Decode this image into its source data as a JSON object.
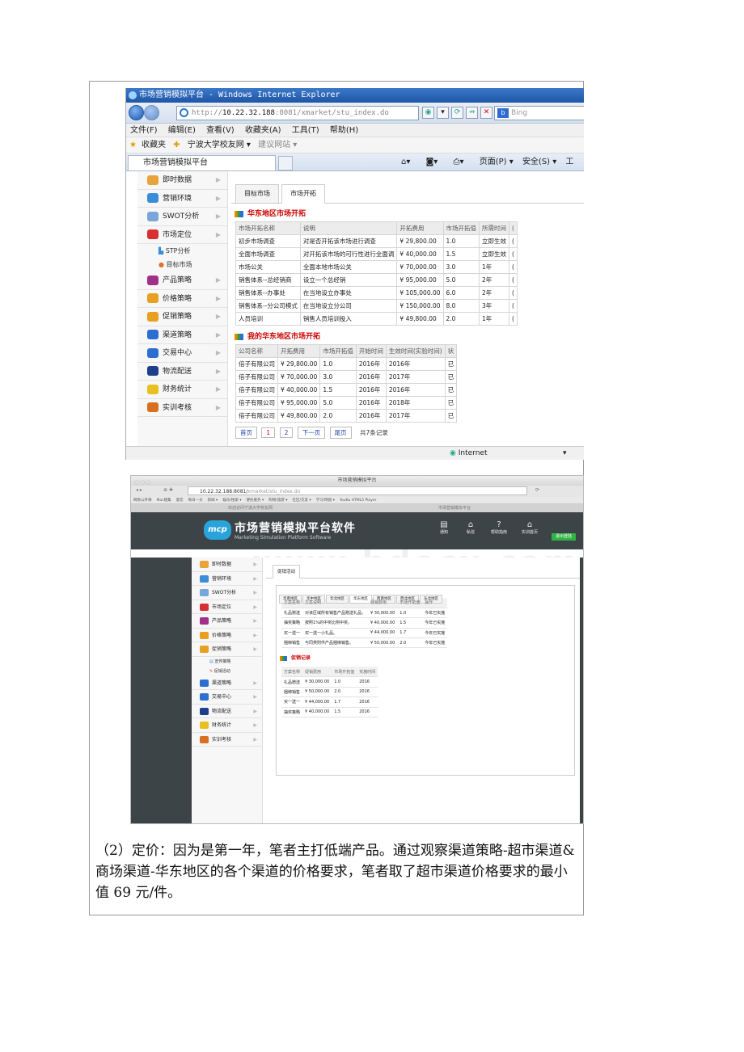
{
  "ie": {
    "title": "市场营销模拟平台 - Windows Internet Explorer",
    "url_prefix": "http://",
    "url_host": "10.22.32.188",
    "url_rest": ":8081/xmarket/stu_index.do",
    "search_placeholder": "Bing",
    "menu": [
      "文件(F)",
      "编辑(E)",
      "查看(V)",
      "收藏夹(A)",
      "工具(T)",
      "帮助(H)"
    ],
    "favorites": [
      "收藏夹",
      "宁波大学校友网 ▾",
      "建议网站 ▾"
    ],
    "tab_title": "市场营销模拟平台",
    "commands": [
      "▾",
      "▾",
      "▾",
      "页面(P) ▾",
      "安全(S) ▾",
      "工"
    ],
    "status_zone": "Internet",
    "status_zoom": "▾"
  },
  "sidebar1": {
    "items": [
      {
        "label": "即时数据",
        "color": "#e8a33a"
      },
      {
        "label": "营销环境",
        "color": "#3c8dd8"
      },
      {
        "label": "SWOT分析",
        "color": "#7aa5d8"
      },
      {
        "label": "市场定位",
        "color": "#d83030"
      }
    ],
    "subs": [
      "STP分析",
      "目标市场"
    ],
    "items2": [
      {
        "label": "产品策略",
        "color": "#a0308a"
      },
      {
        "label": "价格策略",
        "color": "#e8a020"
      },
      {
        "label": "促销策略",
        "color": "#e8a020"
      },
      {
        "label": "渠道策略",
        "color": "#2d6fd0"
      },
      {
        "label": "交易中心",
        "color": "#2d6fd0"
      },
      {
        "label": "物流配送",
        "color": "#1e3f8a"
      },
      {
        "label": "财务统计",
        "color": "#e8c020"
      },
      {
        "label": "实训考核",
        "color": "#d87020"
      }
    ]
  },
  "main1": {
    "tabs": [
      "目标市场",
      "市场开拓"
    ],
    "section1_title": "华东地区市场开拓",
    "table1_headers": [
      "市场开拓名称",
      "说明",
      "开拓费用",
      "市场开拓值",
      "所需时间",
      "("
    ],
    "table1_rows": [
      [
        "初步市场调查",
        "对是否开拓该市场进行调查",
        "¥ 29,800.00",
        "1.0",
        "立即生效",
        "("
      ],
      [
        "全面市场调查",
        "对开拓该市场的可行性进行全面调",
        "¥ 40,000.00",
        "1.5",
        "立即生效",
        "("
      ],
      [
        "市场公关",
        "全面本地市场公关",
        "¥ 70,000.00",
        "3.0",
        "1年",
        "("
      ],
      [
        "销售体系--总经销商",
        "设立一个总经销",
        "¥ 95,000.00",
        "5.0",
        "2年",
        "("
      ],
      [
        "销售体系--办事处",
        "在当地设立办事处",
        "¥ 105,000.00",
        "6.0",
        "2年",
        "("
      ],
      [
        "销售体系--分公司模式",
        "在当地设立分公司",
        "¥ 150,000.00",
        "8.0",
        "3年",
        "("
      ],
      [
        "人员培训",
        "销售人员培训投入",
        "¥ 49,800.00",
        "2.0",
        "1年",
        "("
      ]
    ],
    "section2_title": "我的华东地区市场开拓",
    "table2_headers": [
      "公司名称",
      "开拓费用",
      "市场开拓值",
      "开始时间",
      "生效时间(实验时间)",
      "状"
    ],
    "table2_rows": [
      [
        "倍子有限公司",
        "¥ 29,800.00",
        "1.0",
        "2016年",
        "2016年",
        "已"
      ],
      [
        "倍子有限公司",
        "¥ 70,000.00",
        "3.0",
        "2016年",
        "2017年",
        "已"
      ],
      [
        "倍子有限公司",
        "¥ 40,000.00",
        "1.5",
        "2016年",
        "2016年",
        "已"
      ],
      [
        "倍子有限公司",
        "¥ 95,000.00",
        "5.0",
        "2016年",
        "2018年",
        "已"
      ],
      [
        "倍子有限公司",
        "¥ 49,800.00",
        "2.0",
        "2016年",
        "2017年",
        "已"
      ]
    ],
    "pager": {
      "first": "首页",
      "p1": "1",
      "p2": "2",
      "next": "下一页",
      "last": "尾页",
      "total": "共7条记录"
    }
  },
  "safari": {
    "window_title": "市场营销模拟平台",
    "url": "10.22.32.188:8081/",
    "url_rest": "xmarket/stu_index.do",
    "bookmarks": [
      "网易公开课",
      "Mac随集",
      "意宏",
      "每日一文",
      "新闻 ▾",
      "娱乐/搜索 ▾",
      "便民服务 ▾",
      "购物/旅游 ▾",
      "社区/交友 ▾",
      "学习/网盘 ▾",
      "YouKu HTML5 Player"
    ],
    "tab1": "欢迎访问宁波大学校友网",
    "tab2": "市场营销模拟平台",
    "logo": "mcp",
    "app_name": "市场营销模拟平台软件",
    "app_sub": "Marketing Simulation Platform Software",
    "header_buttons": [
      {
        "glyph": "▤",
        "label": "通知"
      },
      {
        "glyph": "⌂",
        "label": "私信"
      },
      {
        "glyph": "?",
        "label": "帮助指南"
      },
      {
        "glyph": "⌂",
        "label": "实训首页"
      }
    ],
    "exit": "退出登陆",
    "watermark": "www.bdocx.com"
  },
  "sidebar2": {
    "items": [
      {
        "label": "即时数据",
        "color": "#e8a33a"
      },
      {
        "label": "营销环境",
        "color": "#3c8dd8"
      },
      {
        "label": "SWOT分析",
        "color": "#7aa5d8"
      },
      {
        "label": "市场定位",
        "color": "#d83030"
      },
      {
        "label": "产品策略",
        "color": "#a0308a"
      },
      {
        "label": "价格策略",
        "color": "#e8a020"
      },
      {
        "label": "促销策略",
        "color": "#e8a020"
      }
    ],
    "subs": [
      "宣传策略",
      "促销活动"
    ],
    "items2": [
      {
        "label": "渠道策略",
        "color": "#2d6fd0"
      },
      {
        "label": "交易中心",
        "color": "#2d6fd0"
      },
      {
        "label": "物流配送",
        "color": "#1e3f8a"
      },
      {
        "label": "财务统计",
        "color": "#e8c020"
      },
      {
        "label": "实训考核",
        "color": "#d87020"
      }
    ]
  },
  "main2": {
    "tab": "促销活动",
    "regions": [
      "华南地区",
      "华中地区",
      "华北地区",
      "华东地区",
      "西南地区",
      "西北地区",
      "东北地区"
    ],
    "active_region": 3,
    "table1_headers": [
      "方案名称",
      "方案说明",
      "促销费用",
      "市场开拓值",
      "操作"
    ],
    "table1_rows": [
      [
        "礼品赠送",
        "对该区域所有销售产品赠送礼品。",
        "¥ 30,000.00",
        "1.0",
        "今年已实施"
      ],
      [
        "抽奖策略",
        "按照1%的中奖比例中奖。",
        "¥ 40,000.00",
        "1.5",
        "今年已实施"
      ],
      [
        "买一送一",
        "买一送一小礼品。",
        "¥ 44,000.00",
        "1.7",
        "今年已实施"
      ],
      [
        "捆绑销售",
        "与同类附件产品捆绑销售。",
        "¥ 50,000.00",
        "2.0",
        "今年已实施"
      ]
    ],
    "section_title": "促销记录",
    "table2_headers": [
      "方案名称",
      "促销费用",
      "市场开拓值",
      "实施时间"
    ],
    "table2_rows": [
      [
        "礼品赠送",
        "¥ 30,000.00",
        "1.0",
        "2016"
      ],
      [
        "捆绑销售",
        "¥ 50,000.00",
        "2.0",
        "2016"
      ],
      [
        "买一送一",
        "¥ 44,000.00",
        "1.7",
        "2016"
      ],
      [
        "抽奖策略",
        "¥ 40,000.00",
        "1.5",
        "2016"
      ]
    ]
  },
  "paragraph": "（2）定价：因为是第一年，笔者主打低端产品。通过观察渠道策略-超市渠道&商场渠道-华东地区的各个渠道的价格要求，笔者取了超市渠道价格要求的最小值 69 元/件。"
}
